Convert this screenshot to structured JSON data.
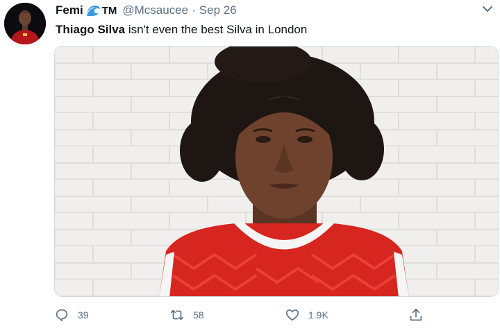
{
  "tweet": {
    "display_name": "Femi",
    "badge_text": "TM",
    "handle": "@Mcsaucee",
    "separator": "·",
    "date": "Sep 26",
    "text_bold": "Thiago Silva",
    "text_rest": " isn't even the best Silva in London"
  },
  "icons": {
    "wave": "wave-emoji-icon",
    "caret": "chevron-down-icon",
    "reply": "reply-icon",
    "retweet": "retweet-icon",
    "like": "heart-icon",
    "share": "share-icon"
  },
  "metrics": {
    "replies": "39",
    "retweets": "58",
    "likes": "1.9K"
  },
  "colors": {
    "muted": "#5b7083",
    "text": "#0f1419",
    "jersey_red": "#d7261f"
  }
}
